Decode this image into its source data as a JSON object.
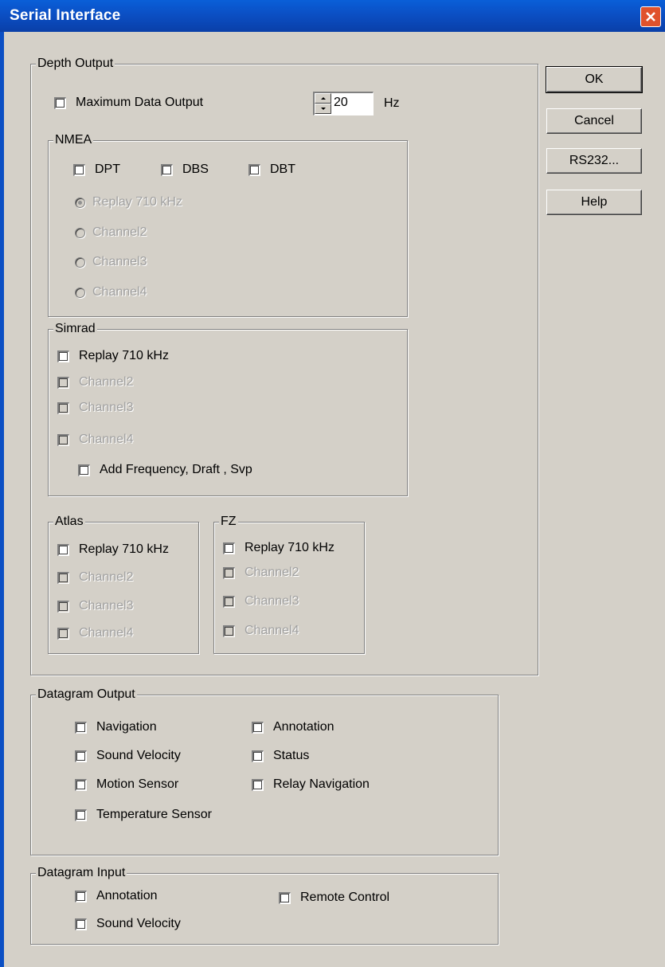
{
  "window": {
    "title": "Serial Interface"
  },
  "buttons": {
    "ok": "OK",
    "cancel": "Cancel",
    "rs232": "RS232...",
    "help": "Help"
  },
  "depth_output": {
    "legend": "Depth Output",
    "max_output_label": "Maximum Data Output",
    "rate_value": "20",
    "rate_unit": "Hz",
    "nmea": {
      "legend": "NMEA",
      "checkboxes": [
        "DPT",
        "DBS",
        "DBT"
      ],
      "radios": [
        "Replay 710 kHz",
        "Channel2",
        "Channel3",
        "Channel4"
      ],
      "selected": "Replay 710 kHz"
    },
    "simrad": {
      "legend": "Simrad",
      "items": [
        "Replay 710 kHz",
        "Channel2",
        "Channel3",
        "Channel4"
      ],
      "add_label": "Add Frequency, Draft , Svp"
    },
    "atlas": {
      "legend": "Atlas",
      "items": [
        "Replay 710 kHz",
        "Channel2",
        "Channel3",
        "Channel4"
      ]
    },
    "fz": {
      "legend": "FZ",
      "items": [
        "Replay 710 kHz",
        "Channel2",
        "Channel3",
        "Channel4"
      ]
    }
  },
  "datagram_output": {
    "legend": "Datagram Output",
    "left": [
      "Navigation",
      "Sound Velocity",
      "Motion Sensor",
      "Temperature Sensor"
    ],
    "right": [
      "Annotation",
      "Status",
      "Relay Navigation"
    ]
  },
  "datagram_input": {
    "legend": "Datagram Input",
    "items": [
      "Annotation",
      "Sound Velocity",
      "Remote Control"
    ]
  }
}
